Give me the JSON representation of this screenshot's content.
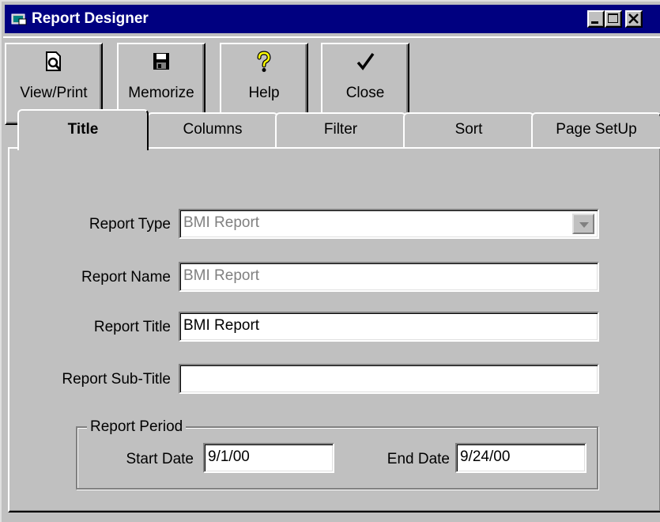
{
  "window": {
    "title": "Report Designer"
  },
  "toolbar": {
    "view_print": "View/Print",
    "memorize": "Memorize",
    "help": "Help",
    "close": "Close"
  },
  "tabs": [
    {
      "label": "Title"
    },
    {
      "label": "Columns"
    },
    {
      "label": "Filter"
    },
    {
      "label": "Sort"
    },
    {
      "label": "Page SetUp"
    }
  ],
  "form": {
    "report_type_label": "Report Type",
    "report_type_value": "BMI Report",
    "report_name_label": "Report Name",
    "report_name_value": "BMI Report",
    "report_title_label": "Report Title",
    "report_title_value": "BMI Report",
    "report_subtitle_label": "Report Sub-Title",
    "report_subtitle_value": "",
    "report_period_label": "Report Period",
    "start_date_label": "Start Date",
    "start_date_value": "9/1/00",
    "end_date_label": "End Date",
    "end_date_value": "9/24/00"
  },
  "colors": {
    "titlebar": "#000080",
    "face": "#c0c0c0"
  }
}
